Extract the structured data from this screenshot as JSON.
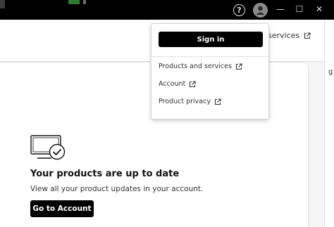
{
  "titlebar": {
    "help_glyph": "?",
    "minimize_glyph": "—",
    "maximize_glyph": "☐",
    "close_glyph": "✕"
  },
  "header": {
    "link_label": "services"
  },
  "account_menu": {
    "sign_in_label": "Sign in",
    "items": [
      {
        "label": "Products and services",
        "icon": "external-link-icon"
      },
      {
        "label": "Account",
        "icon": "external-link-icon"
      },
      {
        "label": "Product privacy",
        "icon": "external-link-icon"
      }
    ]
  },
  "updates_card": {
    "icon": "monitor-check-icon",
    "title": "Your products are up to date",
    "description": "View all your product updates in your account.",
    "button_label": "Go to Account"
  },
  "edge_fragment": "g"
}
